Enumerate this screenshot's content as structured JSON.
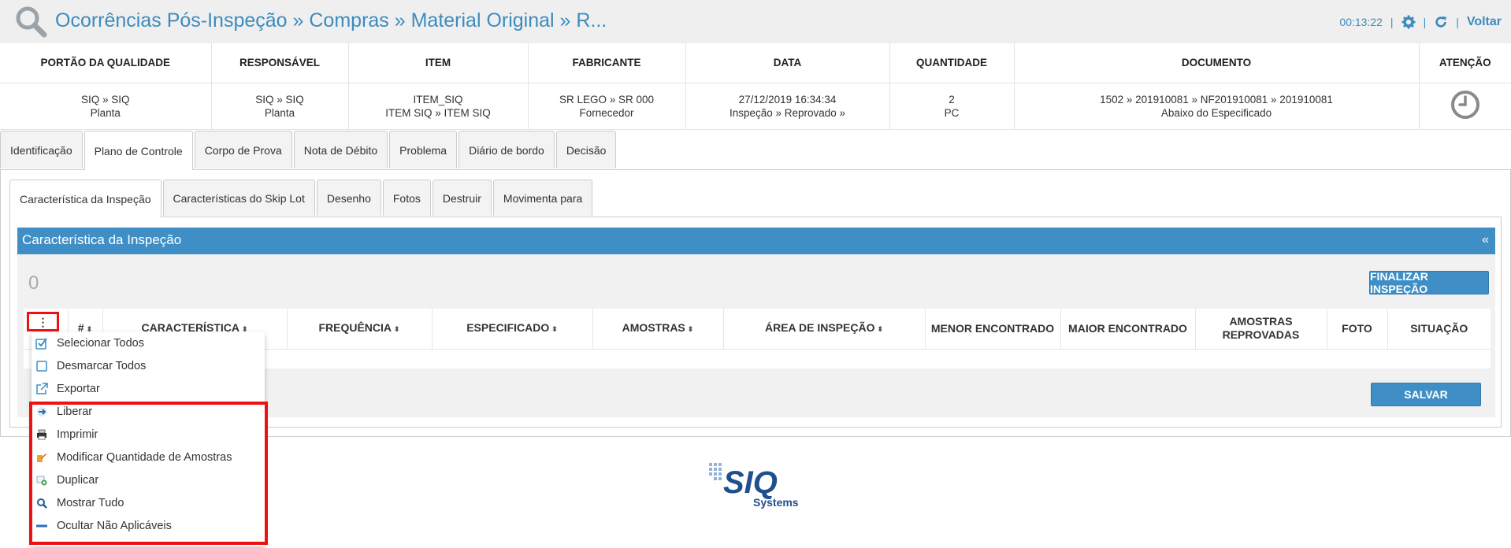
{
  "header": {
    "title": "Ocorrências Pós-Inspeção » Compras » Material Original » R...",
    "timer": "00:13:22",
    "back_label": "Voltar"
  },
  "info": {
    "columns": [
      "PORTÃO DA QUALIDADE",
      "RESPONSÁVEL",
      "ITEM",
      "FABRICANTE",
      "DATA",
      "QUANTIDADE",
      "DOCUMENTO",
      "ATENÇÃO"
    ],
    "row": [
      [
        "SIQ » SIQ",
        "Planta"
      ],
      [
        "SIQ » SIQ",
        "Planta"
      ],
      [
        "ITEM_SIQ",
        "ITEM SIQ » ITEM SIQ"
      ],
      [
        "SR LEGO » SR 000",
        "Fornecedor"
      ],
      [
        "27/12/2019 16:34:34",
        "Inspeção » Reprovado »"
      ],
      [
        "2",
        "PC"
      ],
      [
        "1502 » 201910081 » NF201910081 » 201910081",
        "Abaixo do Especificado"
      ]
    ]
  },
  "outer_tabs": [
    "Identificação",
    "Plano de Controle",
    "Corpo de Prova",
    "Nota de Débito",
    "Problema",
    "Diário de bordo",
    "Decisão"
  ],
  "inner_tabs": [
    "Característica da Inspeção",
    "Características do Skip Lot",
    "Desenho",
    "Fotos",
    "Destruir",
    "Movimenta para"
  ],
  "section": {
    "title": "Característica da Inspeção",
    "collapse": "«",
    "count": "0",
    "finalize_label": "FINALIZAR INSPEÇÃO",
    "save_label": "SALVAR"
  },
  "table": {
    "columns": [
      "#",
      "CARACTERÍSTICA",
      "FREQUÊNCIA",
      "ESPECIFICADO",
      "AMOSTRAS",
      "ÁREA DE INSPEÇÃO",
      "MENOR ENCONTRADO",
      "MAIOR ENCONTRADO",
      "AMOSTRAS REPROVADAS",
      "FOTO",
      "SITUAÇÃO"
    ]
  },
  "menu": {
    "items": [
      {
        "label": "Selecionar Todos",
        "icon": "checkbox-checked-icon"
      },
      {
        "label": "Desmarcar Todos",
        "icon": "checkbox-empty-icon"
      },
      {
        "label": "Exportar",
        "icon": "external-link-icon"
      },
      {
        "label": "Liberar",
        "icon": "arrow-right-icon"
      },
      {
        "label": "Imprimir",
        "icon": "printer-icon"
      },
      {
        "label": "Modificar Quantidade de Amostras",
        "icon": "edit-quantity-icon"
      },
      {
        "label": "Duplicar",
        "icon": "duplicate-icon"
      },
      {
        "label": "Mostrar Tudo",
        "icon": "search-icon"
      },
      {
        "label": "Ocultar Não Aplicáveis",
        "icon": "minus-icon"
      }
    ]
  },
  "logo": {
    "name": "SIQ",
    "sub": "Systems"
  },
  "colors": {
    "accent": "#3f8fc6",
    "highlight": "#ee1111"
  }
}
